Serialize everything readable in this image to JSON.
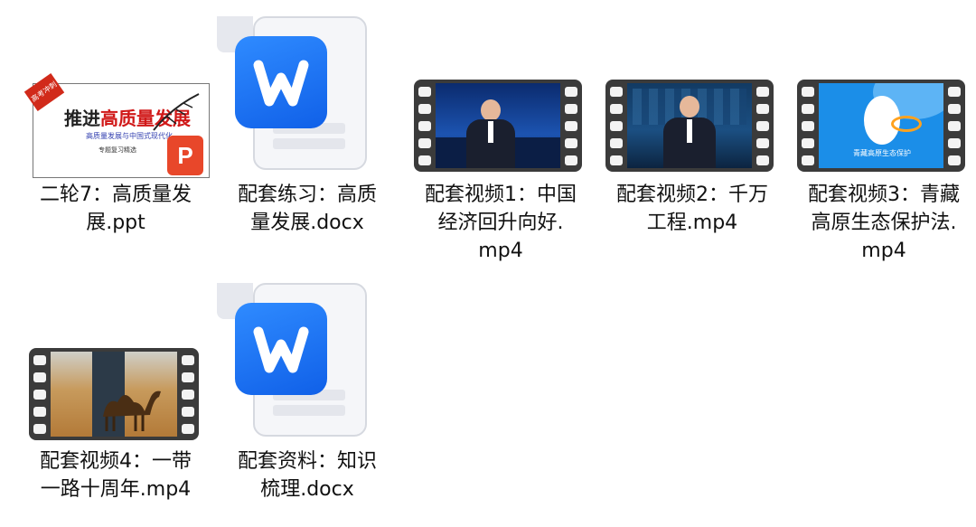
{
  "files": [
    {
      "name": "二轮7：高质量发展.ppt",
      "line1": "二轮7：高质量发",
      "line2": "展.ppt",
      "type": "ppt",
      "thumb": {
        "badge": "高考冲刺",
        "title": "推进高质量发展",
        "sub1": "高质量发展与中国式现代化",
        "sub2": "专题复习精选"
      }
    },
    {
      "name": "配套练习：高质量发展.docx",
      "line1": "配套练习：高质",
      "line2": "量发展.docx",
      "type": "docx"
    },
    {
      "name": "配套视频1：中国经济回升向好.mp4",
      "line1": "配套视频1：中国",
      "line2": "经济回升向好.",
      "line3": "mp4",
      "type": "mp4"
    },
    {
      "name": "配套视频2：千万工程.mp4",
      "line1": "配套视频2：千万",
      "line2": "工程.mp4",
      "type": "mp4"
    },
    {
      "name": "配套视频3：青藏高原生态保护法.mp4",
      "line1": "配套视频3：青藏",
      "line2": "高原生态保护法.",
      "line3": "mp4",
      "type": "mp4",
      "thumb": {
        "caption": "青藏高原生态保护"
      }
    },
    {
      "name": "配套视频4：一带一路十周年.mp4",
      "line1": "配套视频4：一带",
      "line2": "一路十周年.mp4",
      "type": "mp4"
    },
    {
      "name": "配套资料：知识梳理.docx",
      "line1": "配套资料：知识",
      "line2": "梳理.docx",
      "type": "docx"
    }
  ],
  "colors": {
    "ppt_accent": "#e8472a",
    "word_blue": "#1a73f0",
    "film": "#3b3b3b"
  }
}
